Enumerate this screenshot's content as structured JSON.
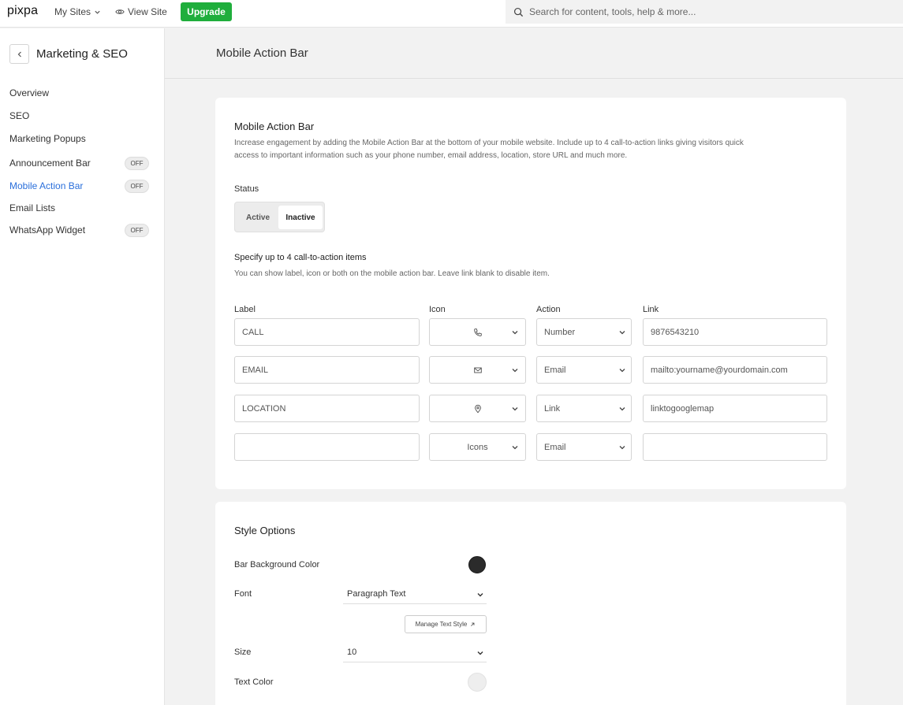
{
  "topbar": {
    "logo": "pixpa",
    "my_sites": "My Sites",
    "view_site": "View Site",
    "upgrade": "Upgrade",
    "search_placeholder": "Search for content, tools, help & more..."
  },
  "sidebar": {
    "title": "Marketing & SEO",
    "items": [
      {
        "label": "Overview",
        "badge": ""
      },
      {
        "label": "SEO",
        "badge": ""
      },
      {
        "label": "Marketing Popups",
        "badge": ""
      },
      {
        "label": "Announcement Bar",
        "badge": "OFF"
      },
      {
        "label": "Mobile Action Bar",
        "badge": "OFF"
      },
      {
        "label": "Email Lists",
        "badge": ""
      },
      {
        "label": "WhatsApp Widget",
        "badge": "OFF"
      }
    ],
    "active_index": 4
  },
  "main": {
    "page_title": "Mobile Action Bar",
    "section": {
      "title": "Mobile Action Bar",
      "description_1": "Increase engagement by adding the Mobile Action Bar at the bottom of your mobile website. Include up to 4 call-to-action links giving visitors quick",
      "description_2": "access to important information such as your phone number, email address, location, store URL and much more.",
      "status_label": "Status",
      "status_options": [
        "Active",
        "Inactive"
      ],
      "status_selected": "Inactive",
      "cta_title": "Specify up to 4 call-to-action items",
      "cta_desc": "You can show label, icon or both on the mobile action bar. Leave link blank to disable item.",
      "columns": [
        "Label",
        "Icon",
        "Action",
        "Link"
      ],
      "rows": [
        {
          "label": "CALL",
          "icon": "phone-icon",
          "icon_text": "",
          "action": "Number",
          "link": "9876543210"
        },
        {
          "label": "EMAIL",
          "icon": "envelope-icon",
          "icon_text": "",
          "action": "Email",
          "link": "mailto:yourname@yourdomain.com"
        },
        {
          "label": "LOCATION",
          "icon": "map-pin-icon",
          "icon_text": "",
          "action": "Link",
          "link": "linktogooglemap"
        },
        {
          "label": "",
          "icon": "",
          "icon_text": "Icons",
          "action": "Email",
          "link": ""
        }
      ]
    },
    "style": {
      "title": "Style Options",
      "bar_bg_label": "Bar Background Color",
      "bar_bg_color": "#2b2b2b",
      "font_label": "Font",
      "font_value": "Paragraph Text",
      "manage_text_style": "Manage Text Style",
      "size_label": "Size",
      "size_value": "10",
      "text_color_label": "Text Color",
      "text_color": "#eeeeee"
    }
  }
}
